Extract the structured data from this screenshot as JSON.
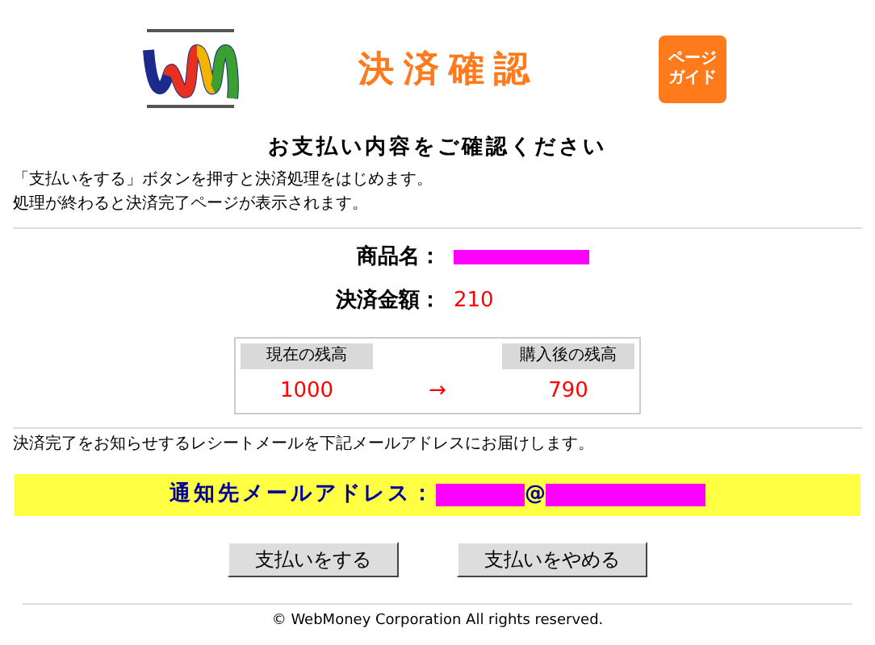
{
  "header": {
    "title": "決済確認",
    "guide_button": [
      "ページ",
      "ガイド"
    ]
  },
  "heading": "お支払い内容をご確認ください",
  "instructions": [
    "「支払いをする」ボタンを押すと決済処理をはじめます。",
    "処理が終わると決済完了ページが表示されます。"
  ],
  "details": [
    {
      "label": "商品名：",
      "redacted": true
    },
    {
      "label": "決済金額：",
      "value": "210"
    }
  ],
  "balance": {
    "before_label": "現在の残高",
    "before": "1000",
    "arrow": "→",
    "after_label": "購入後の残高",
    "after": "790"
  },
  "receipt_note": "決済完了をお知らせするレシートメールを下記メールアドレスにお届けします。",
  "email": {
    "label": "通知先メールアドレス：",
    "at": "@"
  },
  "buttons": [
    "支払いをする",
    "支払いをやめる"
  ],
  "footer": "© WebMoney Corporation All rights reserved."
}
